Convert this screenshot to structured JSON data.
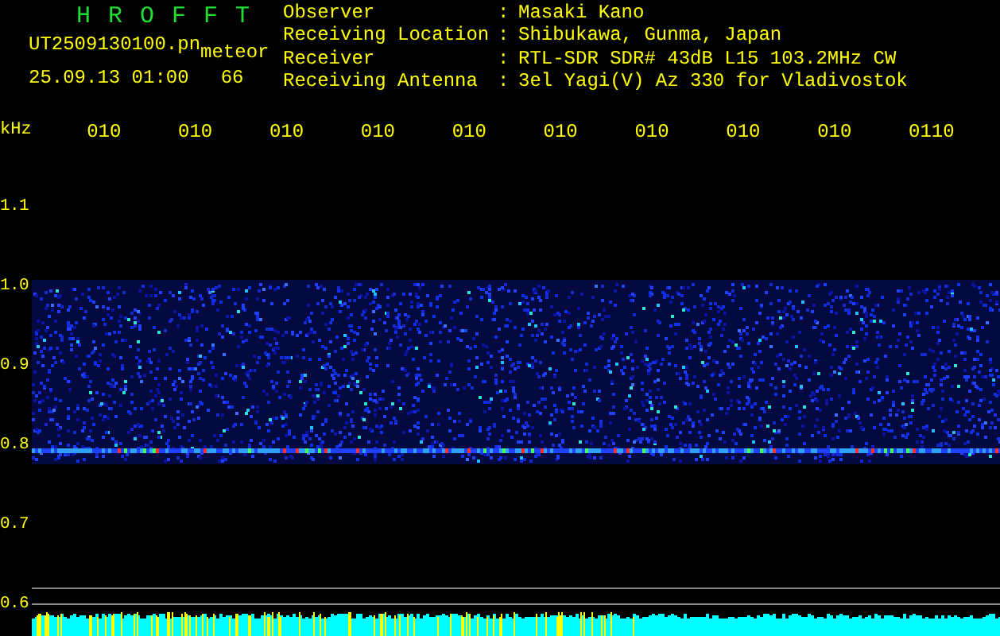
{
  "title": "H R O F F T",
  "file": {
    "name": "UT2509130100.pn",
    "type": "meteor",
    "datetime": "25.09.13 01:00",
    "count": "66"
  },
  "info": [
    {
      "label": "Observer",
      "separator": ":",
      "value": "Masaki Kano"
    },
    {
      "label": "Receiving Location",
      "separator": ":",
      "value": "Shibukawa, Gunma, Japan"
    },
    {
      "label": "Receiver",
      "separator": ":",
      "value": "RTL-SDR SDR# 43dB L15 103.2MHz CW"
    },
    {
      "label": "Receiving Antenna",
      "separator": ":",
      "value": "3el Yagi(V) Az 330 for Vladivostok"
    }
  ],
  "y_unit": "kHz",
  "time_labels": [
    "010",
    "010",
    "010",
    "010",
    "010",
    "010",
    "010",
    "010",
    "010",
    "0110"
  ],
  "y_labels": [
    "1.1",
    "1.0",
    "0.9",
    "0.8",
    "0.7",
    "0.6"
  ]
}
